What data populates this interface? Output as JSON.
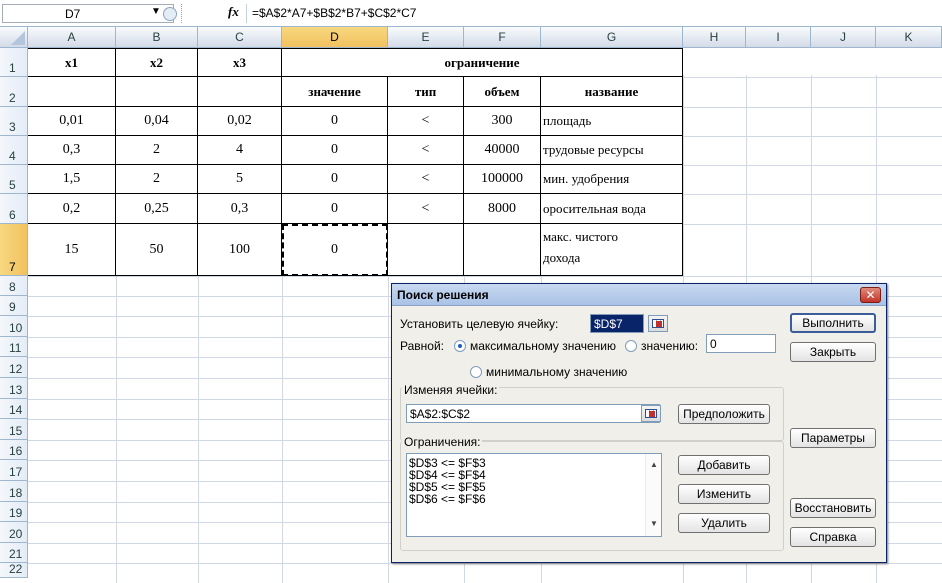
{
  "formula_bar": {
    "name_box": "D7",
    "fx_label": "fx",
    "formula": "=$A$2*A7+$B$2*B7+$C$2*C7"
  },
  "columns": [
    "A",
    "B",
    "C",
    "D",
    "E",
    "F",
    "G",
    "H",
    "I",
    "J",
    "K"
  ],
  "rows": [
    "1",
    "2",
    "3",
    "4",
    "5",
    "6",
    "7",
    "8",
    "9",
    "10",
    "11",
    "12",
    "13",
    "14",
    "15",
    "16",
    "17",
    "18",
    "19",
    "20",
    "21",
    "22"
  ],
  "cells": {
    "A1": "x1",
    "B1": "x2",
    "C1": "x3",
    "D1": "ограничение",
    "D2": "значение",
    "E2": "тип",
    "F2": "объем",
    "G2": "название",
    "A3": "0,01",
    "B3": "0,04",
    "C3": "0,02",
    "D3": "0",
    "E3": "<",
    "F3": "300",
    "G3": "площадь",
    "A4": "0,3",
    "B4": "2",
    "C4": "4",
    "D4": "0",
    "E4": "<",
    "F4": "40000",
    "G4": "трудовые ресурсы",
    "A5": "1,5",
    "B5": "2",
    "C5": "5",
    "D5": "0",
    "E5": "<",
    "F5": "100000",
    "G5": "мин. удобрения",
    "A6": "0,2",
    "B6": "0,25",
    "C6": "0,3",
    "D6": "0",
    "E6": "<",
    "F6": "8000",
    "G6": "оросительная вода",
    "A7": "15",
    "B7": "50",
    "C7": "100",
    "D7": "0",
    "G7a": "макс. чистого",
    "G7b": "дохода"
  },
  "dialog": {
    "title": "Поиск решения",
    "close_glyph": "✕",
    "target_label": "Установить целевую ячейку:",
    "target_value": "$D$7",
    "equal_label": "Равной:",
    "radio_max": "максимальному значению",
    "radio_value": "значению:",
    "value_input": "0",
    "radio_min": "минимальному значению",
    "changing_label": "Изменяя ячейки:",
    "changing_value": "$A$2:$C$2",
    "guess_button": "Предположить",
    "constraints_label": "Ограничения:",
    "constraints": [
      "$D$3 <= $F$3",
      "$D$4 <= $F$4",
      "$D$5 <= $F$5",
      "$D$6 <= $F$6"
    ],
    "add_button": "Добавить",
    "change_button": "Изменить",
    "delete_button": "Удалить",
    "solve_button": "Выполнить",
    "close_button": "Закрыть",
    "options_button": "Параметры",
    "reset_button": "Восстановить",
    "help_button": "Справка",
    "selected_radio": "max"
  },
  "colors": {
    "header_gradient_top": "#f9fcfd",
    "header_gradient_bottom": "#d3dbe9",
    "selected_header": "#f1c15f",
    "gridline": "#d0d7e5",
    "dialog_bg": "#f0efe9",
    "title_bar": "#a9c2e6",
    "close_button": "#c2352a"
  },
  "icons": [
    "name-box-dropdown-icon",
    "fx-icon",
    "range-select-icon",
    "close-icon",
    "scroll-up-icon",
    "scroll-down-icon"
  ]
}
